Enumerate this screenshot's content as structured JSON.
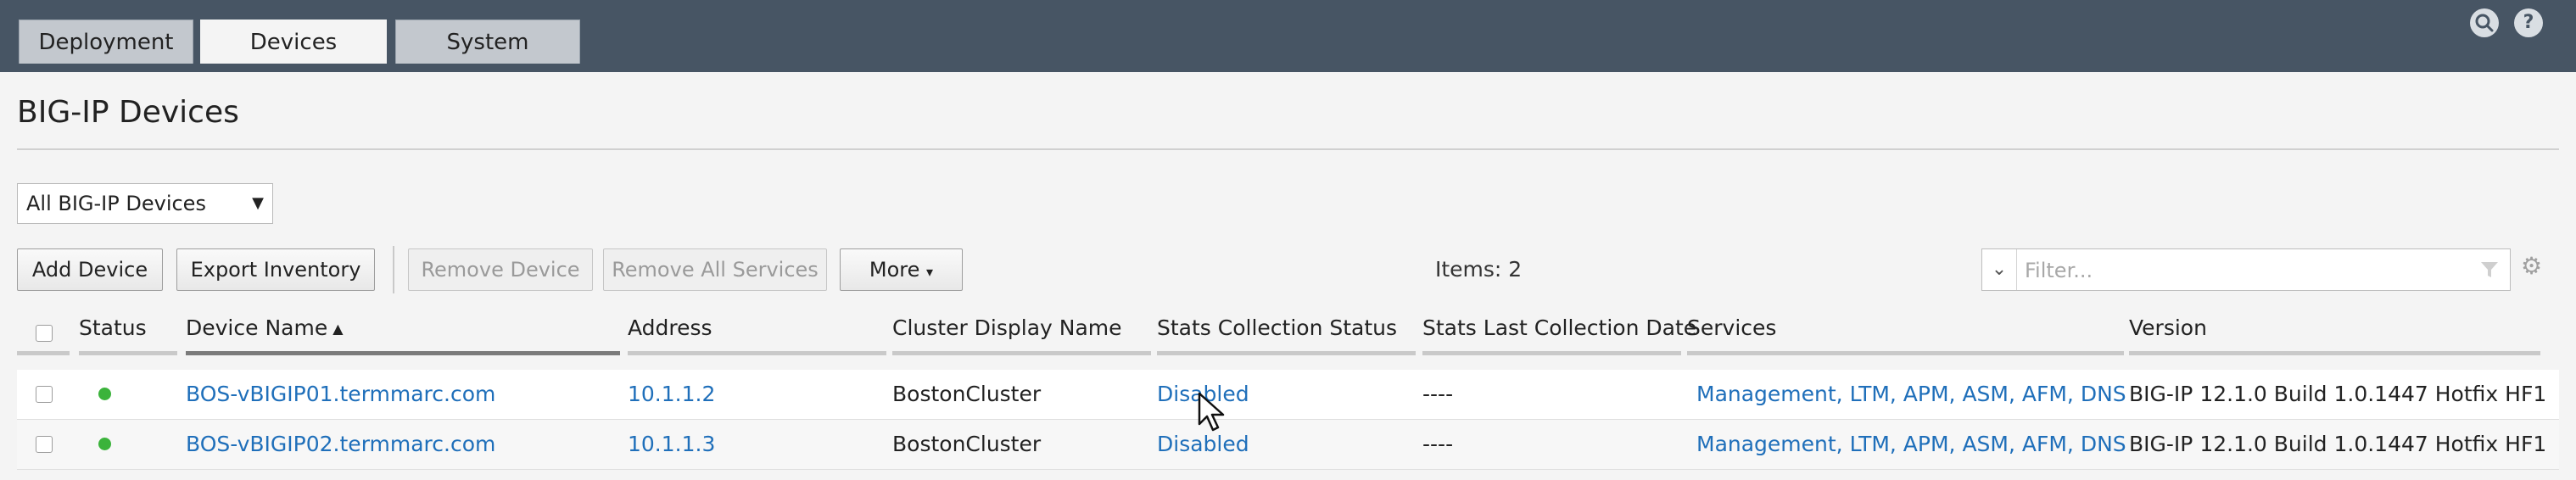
{
  "nav": {
    "tabs": [
      {
        "label": "Deployment",
        "active": false
      },
      {
        "label": "Devices",
        "active": true
      },
      {
        "label": "System",
        "active": false
      }
    ],
    "icons": [
      "search-icon",
      "help-icon"
    ]
  },
  "page": {
    "title": "BIG-IP Devices"
  },
  "filter_select": {
    "selected": "All BIG-IP Devices"
  },
  "toolbar": {
    "add_device": "Add Device",
    "export_inventory": "Export Inventory",
    "remove_device": "Remove Device",
    "remove_all_services": "Remove All Services",
    "more": "More",
    "items_count": "Items: 2",
    "filter_placeholder": "Filter..."
  },
  "table": {
    "columns": [
      "Status",
      "Device Name",
      "Address",
      "Cluster Display Name",
      "Stats Collection Status",
      "Stats Last Collection Date",
      "Services",
      "Version"
    ],
    "sorted_column": "Device Name",
    "rows": [
      {
        "status": "online",
        "device_name": "BOS-vBIGIP01.termmarc.com",
        "address": "10.1.1.2",
        "cluster": "BostonCluster",
        "stats_status": "Disabled",
        "stats_date": "----",
        "services": "Management, LTM, APM, ASM, AFM, DNS",
        "version": "BIG-IP 12.1.0 Build 1.0.1447 Hotfix HF1"
      },
      {
        "status": "online",
        "device_name": "BOS-vBIGIP02.termmarc.com",
        "address": "10.1.1.3",
        "cluster": "BostonCluster",
        "stats_status": "Disabled",
        "stats_date": "----",
        "services": "Management, LTM, APM, ASM, AFM, DNS",
        "version": "BIG-IP 12.1.0 Build 1.0.1447 Hotfix HF1"
      }
    ]
  },
  "colors": {
    "topbar": "#475564",
    "link": "#1f6fba",
    "status_online": "#3bb33b"
  }
}
